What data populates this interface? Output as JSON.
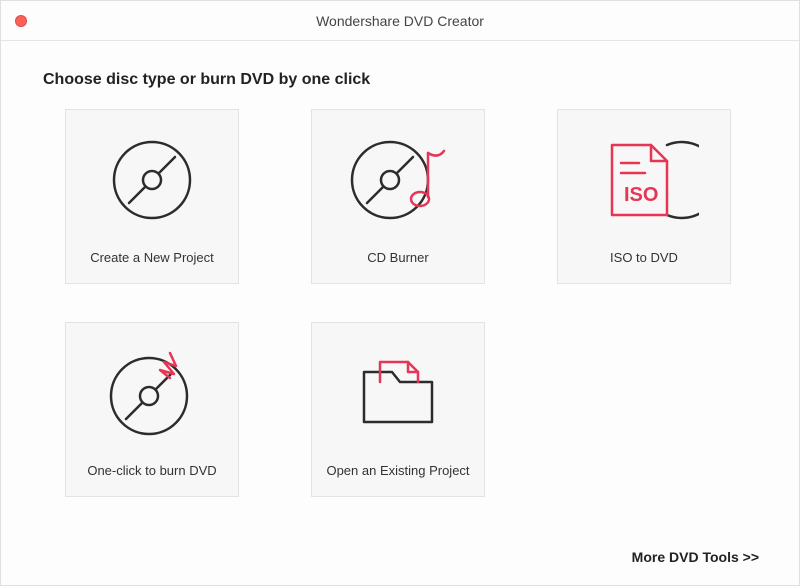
{
  "titlebar": {
    "title": "Wondershare DVD Creator"
  },
  "heading": "Choose disc type or burn DVD by one click",
  "cards": [
    {
      "label": "Create a New Project",
      "icon": "disc-icon"
    },
    {
      "label": "CD Burner",
      "icon": "disc-music-icon"
    },
    {
      "label": "ISO to DVD",
      "icon": "iso-file-icon"
    },
    {
      "label": "One-click to burn DVD",
      "icon": "disc-burn-icon"
    },
    {
      "label": "Open an Existing Project",
      "icon": "folder-open-icon"
    }
  ],
  "footer": {
    "more_tools": "More DVD Tools >>"
  },
  "colors": {
    "accent": "#e73556",
    "stroke": "#2c2c2c"
  }
}
